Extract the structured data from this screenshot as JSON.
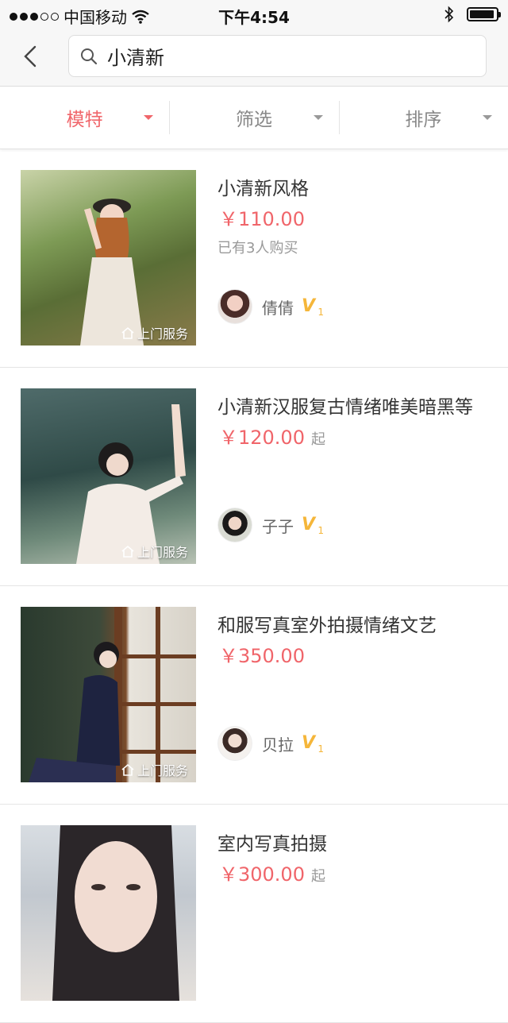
{
  "status_bar": {
    "carrier": "中国移动",
    "time": "下午4:54",
    "signal_filled": 3,
    "signal_total": 5,
    "battery_level": 0.95
  },
  "header": {
    "search_value": "小清新",
    "icons": {
      "back": "chevron-left-icon",
      "search": "search-icon"
    }
  },
  "filters": [
    {
      "label": "模特",
      "active": true
    },
    {
      "label": "筛选",
      "active": false
    },
    {
      "label": "排序",
      "active": false
    }
  ],
  "colors": {
    "accent": "#f0656a",
    "badge": "#f5b63a"
  },
  "items": [
    {
      "title": "小清新风格",
      "price": "￥110.00",
      "from": "",
      "sold": "已有3人购买",
      "badge": "上门服务",
      "seller": "倩倩",
      "level": "1"
    },
    {
      "title": "小清新汉服复古情绪唯美暗黑等",
      "price": "￥120.00",
      "from": "起",
      "sold": "",
      "badge": "上门服务",
      "seller": "子子",
      "level": "1"
    },
    {
      "title": "和服写真室外拍摄情绪文艺",
      "price": "￥350.00",
      "from": "",
      "sold": "",
      "badge": "上门服务",
      "seller": "贝拉",
      "level": "1"
    },
    {
      "title": "室内写真拍摄",
      "price": "￥300.00",
      "from": "起",
      "sold": "",
      "badge": "",
      "seller": "",
      "level": ""
    }
  ]
}
